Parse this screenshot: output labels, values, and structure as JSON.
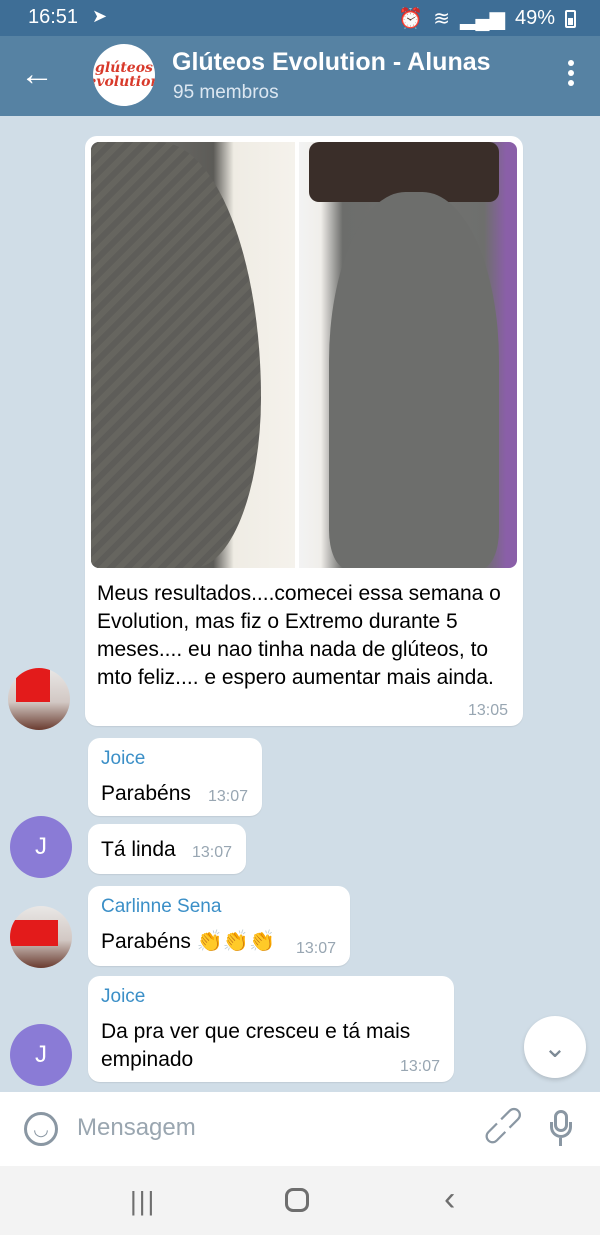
{
  "status_bar": {
    "time": "16:51",
    "battery": "49%"
  },
  "header": {
    "title": "Glúteos Evolution - Alunas",
    "subtitle": "95 membros",
    "avatar_logo": "glúteos evolution"
  },
  "messages": [
    {
      "type": "photo",
      "caption": "Meus resultados....comecei essa semana o Evolution, mas fiz o Extremo durante 5 meses.... eu nao tinha nada de glúteos,  to mto feliz.... e espero aumentar mais ainda.",
      "time": "13:05"
    },
    {
      "sender": "Joice",
      "text": "Parabéns",
      "time": "13:07"
    },
    {
      "text": "Tá linda",
      "time": "13:07",
      "avatar_letter": "J"
    },
    {
      "sender": "Carlinne Sena",
      "text": "Parabéns 👏👏👏",
      "time": "13:07"
    },
    {
      "sender": "Joice",
      "text": "Da pra ver que cresceu e tá mais empinado",
      "time": "13:07",
      "avatar_letter": "J"
    }
  ],
  "input": {
    "placeholder": "Mensagem"
  },
  "icons": {
    "back": "back-arrow-icon",
    "menu": "more-vertical-icon",
    "emoji": "emoji-icon",
    "attach": "paperclip-icon",
    "mic": "microphone-icon",
    "scroll_down": "chevron-down-icon"
  }
}
